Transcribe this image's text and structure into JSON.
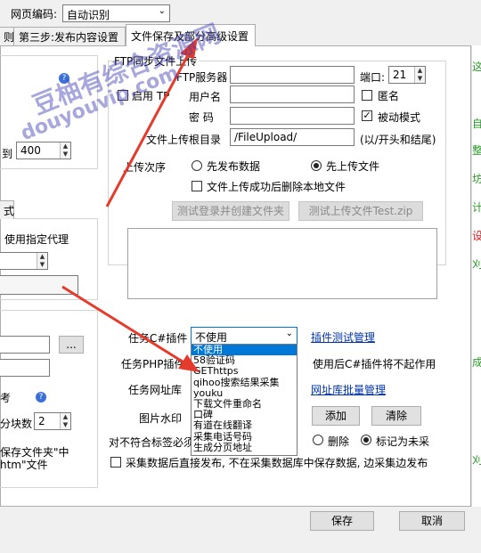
{
  "header": {
    "encoding_label": "网页编码:",
    "encoding_value": "自动识别"
  },
  "tabs": [
    {
      "label": "则"
    },
    {
      "label": "第三步:发布内容设置"
    },
    {
      "label": "文件保存及部分高级设置"
    }
  ],
  "left_panel": {
    "to_label": "到",
    "to_value": "400",
    "proxy_tab": "式",
    "proxy_label": "使用指定代理",
    "browse_button": "...",
    "side_char": "考",
    "split_label": "分块数",
    "split_value": "2",
    "save_folder_note": "保存文件夹\"中",
    "htm_note": "htm\"文件"
  },
  "ftp": {
    "group_title": "FTP同步文件上传",
    "enable_label": "启用 TP",
    "server_label": "FTP服务器",
    "server_value": "",
    "port_label": "端口:",
    "port_value": "21",
    "user_label": "用户名",
    "user_value": "",
    "anonymous_label": "匿名",
    "password_label": "密  码",
    "password_value": "",
    "passive_label": "被动模式",
    "upload_dir_label": "文件上传根目录",
    "upload_dir_value": "/FileUpload/",
    "upload_dir_hint": "(以/开头和结尾)",
    "order_label": "上传次序",
    "order_opt_first_publish": "先发布数据",
    "order_opt_first_upload": "先上传文件",
    "delete_local_label": "文件上传成功后删除本地文件",
    "test_login_button": "测试登录并创建文件夹",
    "test_upload_button": "测试上传文件Test.zip"
  },
  "plugins": {
    "csharp_label": "任务C#插件",
    "csharp_value": "不使用",
    "plugin_manage_link": "插件测试管理",
    "php_label": "任务PHP插件",
    "php_note": "使用后C#插件将不起作用",
    "url_lib_label": "任务网址库",
    "url_lib_link": "网址库批量管理",
    "watermark_label": "图片水印",
    "add_button": "添加",
    "clear_button": "清除",
    "nonconform_label": "对不符合标签必须",
    "delete_label": "删除",
    "mark_unused_label": "标记为未采",
    "direct_publish_label": "采集数据后直接发布, 不在采集数据库中保存数据, 边采集边发布",
    "dropdown_options": [
      "不使用",
      "58验证码",
      "GEThttps",
      "qihoo搜索结果采集",
      "youku",
      "下载文件重命名",
      "口碑",
      "有道在线翻译",
      "采集电话号码",
      "生成分页地址"
    ]
  },
  "footer": {
    "save_button": "保存",
    "cancel_button": "取消"
  },
  "right_edge": {
    "chars": [
      "这",
      "自",
      "整",
      "坊",
      "计",
      "设",
      "刈",
      "成",
      "刈"
    ]
  },
  "watermark": {
    "line1": "豆柚有综合资源网",
    "line2": "douyouvip.com"
  },
  "colors": {
    "selection": "#0078d7",
    "link": "#0033aa",
    "arrow": "#e53b2c"
  }
}
